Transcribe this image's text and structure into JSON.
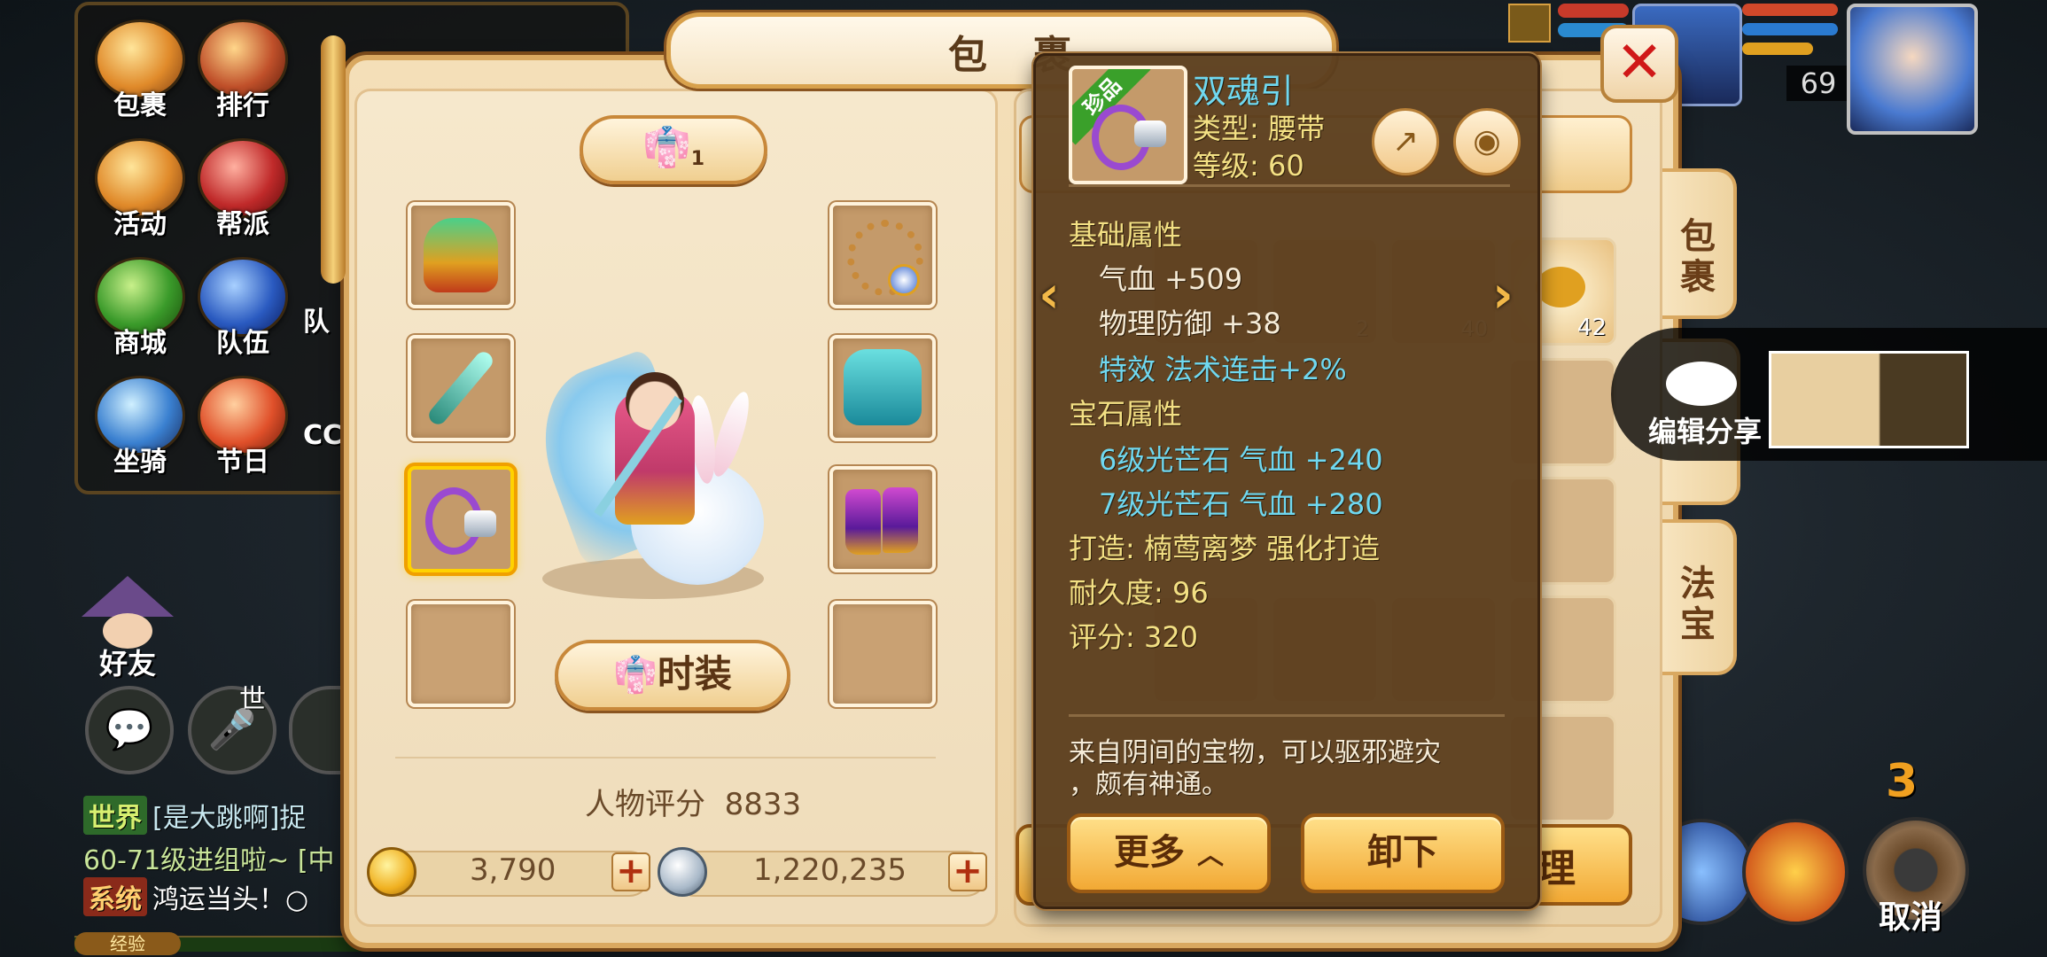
{
  "hud": {
    "menu": [
      {
        "label": "包裹",
        "icon": "bag-icon"
      },
      {
        "label": "排行",
        "icon": "ranking-icon"
      },
      {
        "label": "活动",
        "icon": "horn-icon"
      },
      {
        "label": "帮派",
        "icon": "guild-icon"
      },
      {
        "label": "商城",
        "icon": "shop-icon"
      },
      {
        "label": "队伍",
        "icon": "team-icon"
      },
      {
        "label": "坐骑",
        "icon": "mount-icon"
      },
      {
        "label": "节日",
        "icon": "festival-icon"
      }
    ],
    "cut_labels": [
      "队",
      "系",
      "CC"
    ],
    "friend_label": "好友",
    "world_mark": "世",
    "chat": [
      {
        "tag": "世界",
        "text": "[是大跳啊]捉"
      },
      {
        "tag": "",
        "text": "60-71级进组啦~ [中"
      },
      {
        "tag": "系统",
        "text": "鸿运当头！○"
      }
    ],
    "exp_label": "经验",
    "level": "69",
    "cancel_label": "取消",
    "skill_count": "3"
  },
  "window": {
    "title": "包 裹",
    "outfit_count": "1",
    "fashion_label": "时装",
    "score_label": "人物评分",
    "score_value": "8833",
    "gold_value": "3,790",
    "silver_value": "1,220,235",
    "plus": "+",
    "bag_counts": [
      "42",
      "40",
      "2"
    ],
    "hidden_button_tail": "理"
  },
  "side_tabs": [
    "包裹",
    "法宝"
  ],
  "tooltip": {
    "badge": "珍品",
    "name": "双魂引",
    "type": "类型: 腰带",
    "level": "等级: 60",
    "base_header": "基础属性",
    "base_stats": [
      "气血  +509",
      "物理防御 +38"
    ],
    "effect": "特效  法术连击+2%",
    "gem_header": "宝石属性",
    "gem_stats": [
      "6级光芒石  气血  +240",
      "7级光芒石  气血  +280"
    ],
    "forge": "打造: 楠莺离梦    强化打造",
    "durability": "耐久度: 96",
    "rating": "评分: 320",
    "description": "来自阴间的宝物，可以驱邪避灾，颇有神通。",
    "desc_line1": "来自阴间的宝物，可以驱邪避灾",
    "desc_line2": "，颇有神通。",
    "more_label": "更多",
    "unequip_label": "卸下"
  },
  "share": {
    "label": "编辑分享"
  },
  "colors": {
    "accent_gold": "#f3e084",
    "cyan": "#6fd8f0",
    "close_red": "#d01818",
    "select": "#ffd200"
  }
}
